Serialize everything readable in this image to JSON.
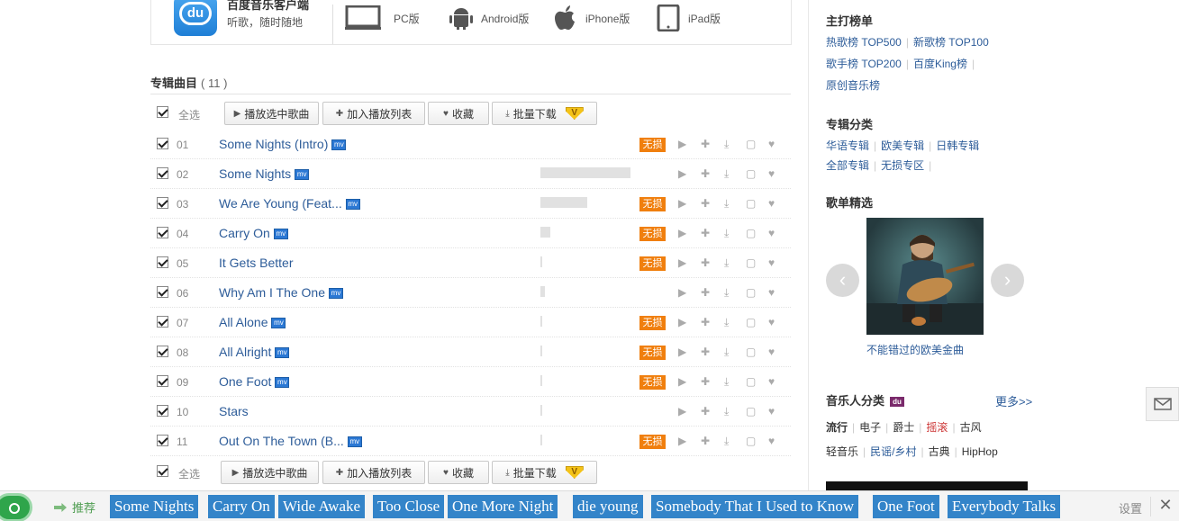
{
  "client": {
    "title": "百度音乐客户端",
    "subtitle": "听歌，随时随地",
    "platforms": [
      {
        "icon": "monitor-icon",
        "label": "PC版"
      },
      {
        "icon": "android-icon",
        "label": "Android版"
      },
      {
        "icon": "apple-icon",
        "label": "iPhone版"
      },
      {
        "icon": "tablet-icon",
        "label": "iPad版"
      }
    ]
  },
  "album": {
    "heading": "专辑曲目",
    "count": "( 11 )",
    "select_all": "全选",
    "toolbar": {
      "play_selected": "播放选中歌曲",
      "add_to_playlist": "加入播放列表",
      "favorite": "收藏",
      "batch_download": "批量下载"
    },
    "tracks": [
      {
        "num": "01",
        "title": "Some Nights (Intro)",
        "mv": true,
        "popularity": 0.0,
        "lossless": true
      },
      {
        "num": "02",
        "title": "Some Nights",
        "mv": true,
        "popularity": 1.0,
        "lossless": false
      },
      {
        "num": "03",
        "title": "We Are Young (Feat...",
        "mv": true,
        "popularity": 0.52,
        "lossless": true
      },
      {
        "num": "04",
        "title": "Carry On",
        "mv": true,
        "popularity": 0.11,
        "lossless": true
      },
      {
        "num": "05",
        "title": "It Gets Better",
        "mv": false,
        "popularity": 0.02,
        "lossless": true
      },
      {
        "num": "06",
        "title": "Why Am I The One",
        "mv": true,
        "popularity": 0.05,
        "lossless": false
      },
      {
        "num": "07",
        "title": "All Alone",
        "mv": true,
        "popularity": 0.02,
        "lossless": true
      },
      {
        "num": "08",
        "title": "All Alright",
        "mv": true,
        "popularity": 0.02,
        "lossless": true
      },
      {
        "num": "09",
        "title": "One Foot",
        "mv": true,
        "popularity": 0.02,
        "lossless": true
      },
      {
        "num": "10",
        "title": "Stars",
        "mv": false,
        "popularity": 0.02,
        "lossless": false
      },
      {
        "num": "11",
        "title": "Out On The Town (B...",
        "mv": true,
        "popularity": 0.02,
        "lossless": true
      }
    ],
    "lossless_label": "无损",
    "mv_label": "mv",
    "vip_label": "V"
  },
  "sidebar": {
    "charts_title": "主打榜单",
    "charts_row1": [
      "热歌榜 TOP500",
      "新歌榜 TOP100"
    ],
    "charts_row2": [
      "歌手榜 TOP200",
      "百度King榜"
    ],
    "charts_row3": [
      "原创音乐榜"
    ],
    "album_cat_title": "专辑分类",
    "album_cat_row1": [
      "华语专辑",
      "欧美专辑",
      "日韩专辑"
    ],
    "album_cat_row2": [
      "全部专辑",
      "无损专区"
    ],
    "playlist_title": "歌单精选",
    "playlist_caption": "不能错过的欧美金曲",
    "musician_title": "音乐人分类",
    "more": "更多>>",
    "genres_row1": [
      "流行",
      "电子",
      "爵士",
      "摇滚",
      "古风"
    ],
    "genres_row2": [
      "轻音乐",
      "民谣/乡村",
      "古典",
      "HipHop"
    ]
  },
  "bottom_bar": {
    "recommend": "推荐",
    "tags": [
      "Some Nights",
      "Carry On",
      "Wide Awake",
      "Too Close",
      "One More Night",
      "die young",
      "Somebody That I Used to Know",
      "One Foot",
      "Everybody Talks"
    ],
    "settings": "设置"
  },
  "colors": {
    "link": "#2d5c99",
    "lossless": "#f07f0e",
    "tag_bg": "#3384c9",
    "accent_green": "#2fa54b"
  }
}
